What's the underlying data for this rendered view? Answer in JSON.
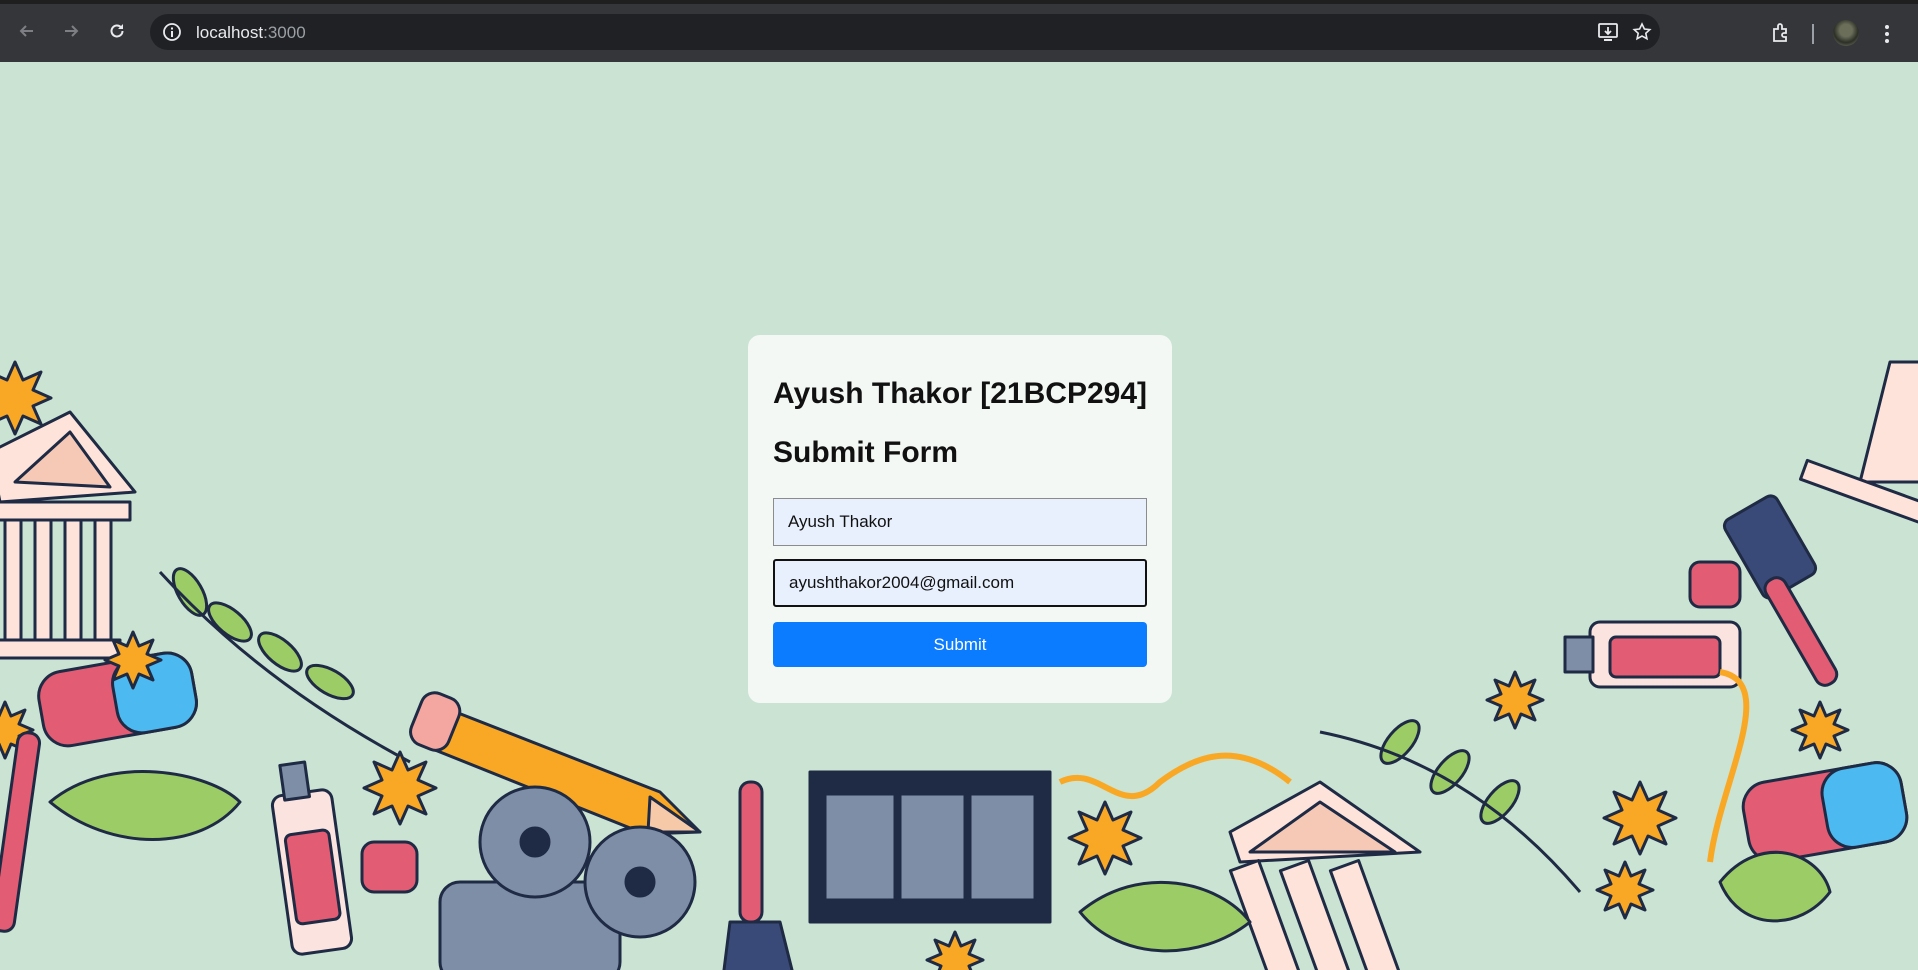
{
  "browser": {
    "url_host": "localhost",
    "url_port": ":3000"
  },
  "form": {
    "heading": "Ayush Thakor [21BCP294]",
    "subheading": "Submit Form",
    "name_value": "Ayush Thakor",
    "email_value": "ayushthakor2004@gmail.com",
    "submit_label": "Submit"
  },
  "colors": {
    "page_background": "#cae3d3",
    "submit_button": "#0b7bff"
  }
}
